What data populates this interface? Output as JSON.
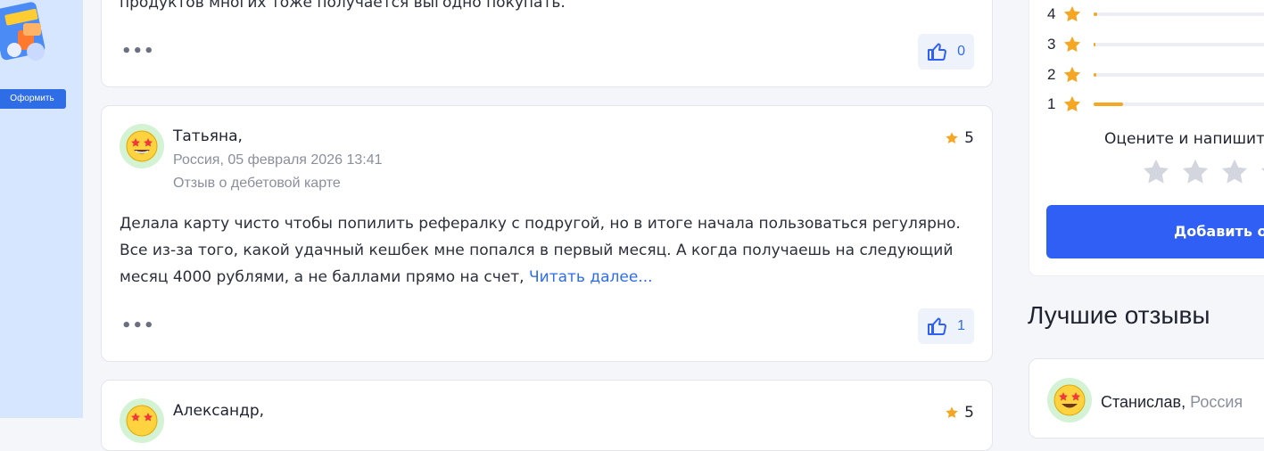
{
  "colors": {
    "accent": "#2f6de6",
    "star": "#f5a623",
    "button": "#2f5ff5"
  },
  "promo": {
    "button_label": "Оформить"
  },
  "review_prev": {
    "text_tail": "продуктов многих тоже получается выгодно покупать.",
    "likes": "0"
  },
  "review_main": {
    "author": "Татьяна,",
    "location_date": "Россия, 05 февраля 2026 13:41",
    "subject": "Отзыв о дебетовой карте",
    "rating": "5",
    "text": "Делала карту чисто чтобы попилить рефералку с подругой, но в итоге начала пользоваться регулярно. Все из-за того, какой удачный кешбек мне попался в первый месяц. А когда получаешь на следующий месяц 4000 рублями, а не баллами прямо на счет, ",
    "read_more": "Читать далее...",
    "likes": "1"
  },
  "review_next": {
    "author": "Александр,",
    "rating": "5"
  },
  "rating_summary": {
    "rows": [
      {
        "stars": "4",
        "fill": 0.02
      },
      {
        "stars": "3",
        "fill": 0.0
      },
      {
        "stars": "2",
        "fill": 0.01
      },
      {
        "stars": "1",
        "fill": 0.15
      }
    ],
    "prompt": "Оцените и напишите",
    "add_button": "Добавить от"
  },
  "best_reviews": {
    "title": "Лучшие отзывы",
    "author": "Станислав,",
    "country": "Россия"
  }
}
